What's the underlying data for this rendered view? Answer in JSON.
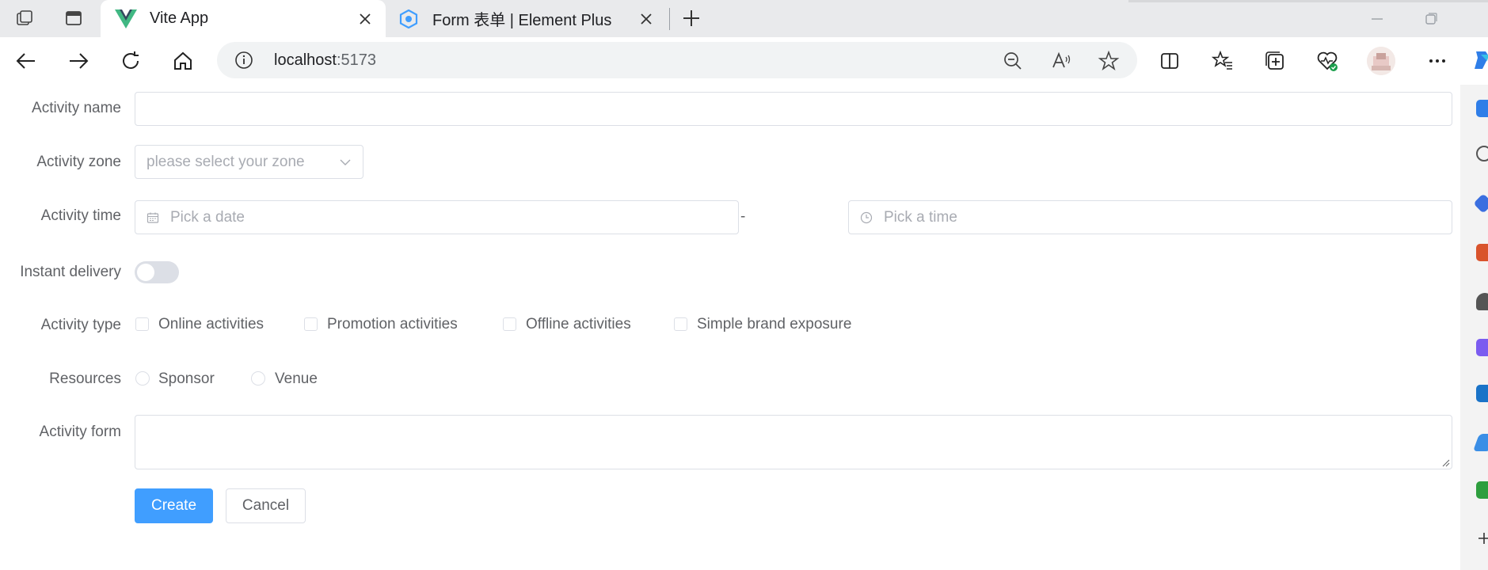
{
  "browser": {
    "tabs": [
      {
        "title": "Vite App",
        "active": true,
        "icon": "vue-logo-icon"
      },
      {
        "title": "Form 表单 | Element Plus",
        "active": false,
        "icon": "element-plus-logo-icon"
      }
    ],
    "address": {
      "host": "localhost",
      "port": ":5173"
    }
  },
  "form": {
    "labels": {
      "name": "Activity name",
      "zone": "Activity zone",
      "time": "Activity time",
      "delivery": "Instant delivery",
      "type": "Activity type",
      "resources": "Resources",
      "desc": "Activity form"
    },
    "zone_placeholder": "please select your zone",
    "date_placeholder": "Pick a date",
    "time_separator": "-",
    "time_placeholder": "Pick a time",
    "instant_delivery_on": false,
    "types": [
      "Online activities",
      "Promotion activities",
      "Offline activities",
      "Simple brand exposure"
    ],
    "resources": [
      "Sponsor",
      "Venue"
    ],
    "buttons": {
      "create": "Create",
      "cancel": "Cancel"
    }
  },
  "colors": {
    "primary": "#409eff",
    "border": "#dcdfe6",
    "placeholder": "#a8abb2",
    "label": "#606266"
  }
}
